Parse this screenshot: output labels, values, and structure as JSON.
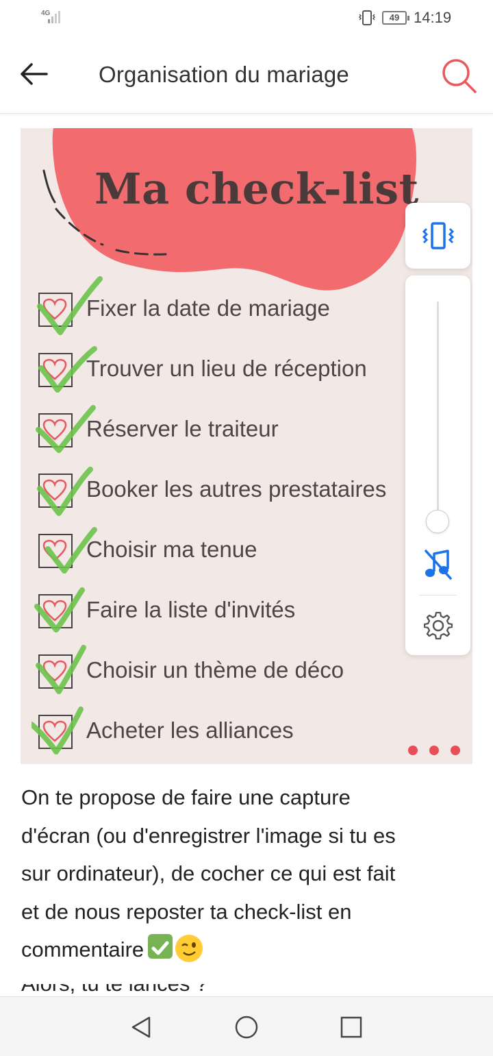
{
  "status_bar": {
    "network": "4G",
    "battery": "49",
    "time": "14:19"
  },
  "header": {
    "title": "Organisation du mariage",
    "back_icon": "arrow-left-icon",
    "search_icon": "search-icon",
    "accent_color": "#e8595f"
  },
  "checklist_image": {
    "title": "Ma check-list",
    "items": [
      "Fixer la date de mariage",
      "Trouver un lieu de réception",
      "Réserver le traiteur",
      "Booker les autres prestataires",
      "Choisir ma tenue",
      "Faire la liste d'invités",
      "Choisir un thème de déco",
      "Acheter les alliances"
    ],
    "blob_color": "#f26b6f",
    "tick_color": "#6cc24a"
  },
  "volume_panel": {
    "vibrate_icon": "vibrate-icon",
    "music_muted_icon": "music-off-icon",
    "settings_icon": "gear-icon",
    "level": 0
  },
  "post": {
    "line1": "On te propose de faire une capture",
    "line2": "d'écran (ou d'enregistrer l'image si tu es",
    "line3": "sur ordinateur), de cocher ce qui est fait",
    "line4": "et de nous reposter ta check-list en",
    "line5": "commentaire",
    "next_line": "Alors, tu te lances ?"
  },
  "nav_bar": {
    "back_icon": "nav-back-icon",
    "home_icon": "nav-home-icon",
    "recents_icon": "nav-recents-icon"
  }
}
